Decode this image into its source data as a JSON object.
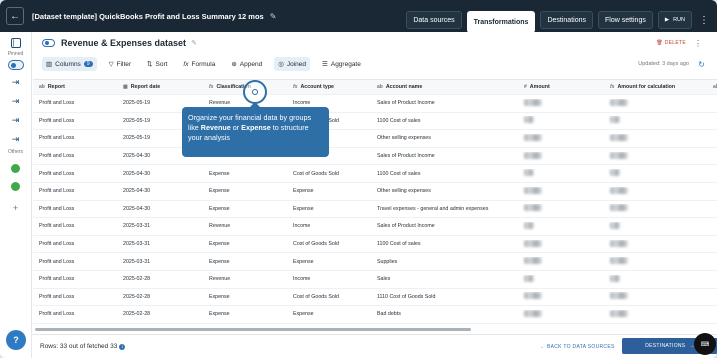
{
  "topbar": {
    "title": "[Dataset template] QuickBooks Profit and Loss Summary 12 mos",
    "tabs": [
      "Data sources",
      "Transformations",
      "Destinations",
      "Flow settings"
    ],
    "active_tab": "Transformations",
    "run_label": "RUN"
  },
  "rail": {
    "pinned_label": "Pinned",
    "others_label": "Others"
  },
  "dataset": {
    "title": "Revenue & Expenses dataset",
    "delete_label": "DELETE"
  },
  "toolbar": {
    "columns_label": "Columns",
    "columns_count": "9",
    "filter_label": "Filter",
    "sort_label": "Sort",
    "formula_label": "Formula",
    "append_label": "Append",
    "joined_label": "Joined",
    "aggregate_label": "Aggregate",
    "updated_label": "Updated: 3 days ago"
  },
  "table": {
    "headers": [
      "Report",
      "Report date",
      "Classification",
      "Account type",
      "Account name",
      "Amount",
      "Amount for calculation"
    ],
    "rows": [
      [
        "Profit and Loss",
        "2025-05-19",
        "Revenue",
        "Income",
        "Sales of Product Income"
      ],
      [
        "Profit and Loss",
        "2025-05-19",
        "",
        "Cost of Goods Sold",
        "1100 Cost of sales"
      ],
      [
        "Profit and Loss",
        "2025-05-19",
        "",
        "",
        "Other selling expenses"
      ],
      [
        "Profit and Loss",
        "2025-04-30",
        "Revenue",
        "Income",
        "Sales of Product Income"
      ],
      [
        "Profit and Loss",
        "2025-04-30",
        "Expense",
        "Cost of Goods Sold",
        "1100 Cost of sales"
      ],
      [
        "Profit and Loss",
        "2025-04-30",
        "Expense",
        "Expense",
        "Other selling expenses"
      ],
      [
        "Profit and Loss",
        "2025-04-30",
        "Expense",
        "Expense",
        "Travel expenses - general and admin expenses"
      ],
      [
        "Profit and Loss",
        "2025-03-31",
        "Revenue",
        "Income",
        "Sales of Product Income"
      ],
      [
        "Profit and Loss",
        "2025-03-31",
        "Expense",
        "Cost of Goods Sold",
        "1100 Cost of sales"
      ],
      [
        "Profit and Loss",
        "2025-03-31",
        "Expense",
        "Expense",
        "Supplies"
      ],
      [
        "Profit and Loss",
        "2025-02-28",
        "Revenue",
        "Income",
        "Sales"
      ],
      [
        "Profit and Loss",
        "2025-02-28",
        "Expense",
        "Cost of Goods Sold",
        "1110 Cost of Goods Sold"
      ],
      [
        "Profit and Loss",
        "2025-02-28",
        "Expense",
        "Expense",
        "Bad debts"
      ]
    ]
  },
  "tooltip": {
    "part1": "Organize your financial data by groups like ",
    "bold1": "Revenue",
    "part2": " or ",
    "bold2": "Expense",
    "part3": " to structure your analysis"
  },
  "footer": {
    "rows_text": "Rows: 33 out of fetched 33",
    "back_label": "BACK TO DATA SOURCES",
    "dest_label": "DESTINATIONS"
  },
  "colors": {
    "topbar": "#1a2835",
    "accent": "#2e6fb5",
    "tooltip": "#2e6fa8",
    "delete": "#c0392b"
  }
}
